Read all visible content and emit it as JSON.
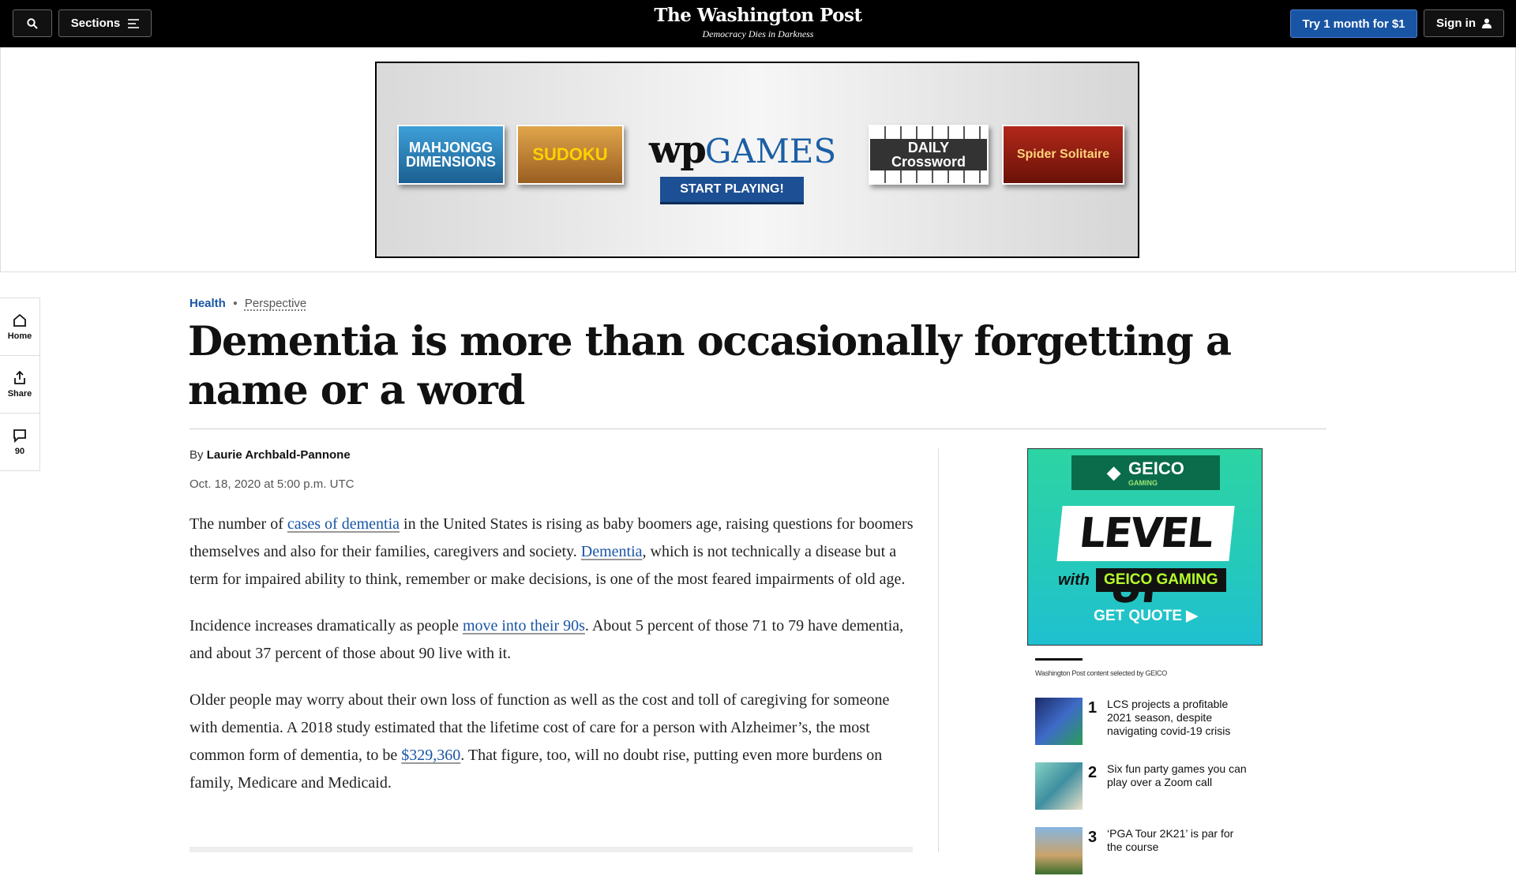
{
  "header": {
    "sections_label": "Sections",
    "logo": "The Washington Post",
    "tagline": "Democracy Dies in Darkness",
    "try_label": "Try 1 month for $1",
    "signin_label": "Sign in"
  },
  "top_ad": {
    "tiles": {
      "mahjongg": "MAHJONGG DIMENSIONS",
      "sudoku": "SUDOKU",
      "crossword": "DAILY Crossword",
      "spider": "Spider Solitaire"
    },
    "brand_wp": "wp",
    "brand_games": "GAMES",
    "cta": "START PLAYING!"
  },
  "rail": {
    "home": "Home",
    "share": "Share",
    "comments": "90"
  },
  "article": {
    "category": "Health",
    "label": "Perspective",
    "headline": "Dementia is more than occasionally forgetting a name or a word",
    "byline_prefix": "By",
    "author": "Laurie Archbald-Pannone",
    "date": "Oct. 18, 2020 at 5:00 p.m. UTC",
    "p1": {
      "t1": "The number of ",
      "link1": "cases of dementia",
      "t2": " in the United States is rising as baby boomers age, raising questions for boomers themselves and also for their families, caregivers and society. ",
      "link2": "Dementia",
      "t3": ", which is not technically a disease but a term for impaired ability to think, remember or make decisions, is one of the most feared impairments of old age."
    },
    "p2": {
      "t1": "Incidence increases dramatically as people ",
      "link1": "move into their 90s",
      "t2": ". About 5 percent of those 71 to 79 have dementia, and about 37 percent of those about 90 live with it."
    },
    "p3": {
      "t1": "Older people may worry about their own loss of function as well as the cost and toll of caregiving for someone with dementia. A 2018 study estimated that the lifetime cost of care for a person with Alzheimer’s, the most common form of dementia, to be ",
      "link1": "$329,360",
      "t2": ". That figure, too, will no doubt rise, putting even more burdens on family, Medicare and Medicaid."
    }
  },
  "side_ad": {
    "brand": "GEICO",
    "brand_sub": "GAMING",
    "headline": "LEVEL UP",
    "with": "with",
    "with_brand": "GEICO GAMING",
    "cta": "GET QUOTE ▶",
    "selected_by": "Washington Post content selected by GEICO",
    "items": [
      {
        "num": "1",
        "text": "LCS projects a profitable 2021 season, despite navigating covid-19 crisis"
      },
      {
        "num": "2",
        "text": "Six fun party games you can play over a Zoom call"
      },
      {
        "num": "3",
        "text": "‘PGA Tour 2K21’ is par for the course"
      }
    ]
  }
}
